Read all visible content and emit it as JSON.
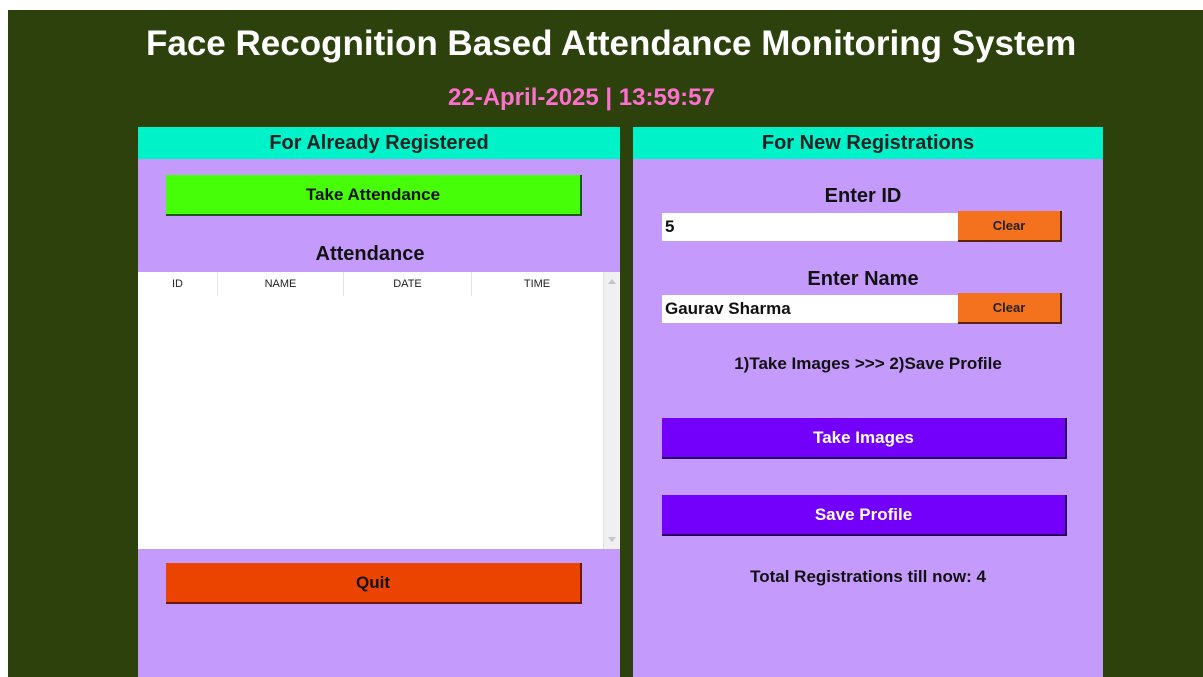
{
  "header": {
    "title": "Face Recognition Based Attendance Monitoring System",
    "datetime": "22-April-2025  | 13:59:57"
  },
  "left_panel": {
    "heading": "For Already Registered",
    "take_attendance_label": "Take Attendance",
    "attendance_label": "Attendance",
    "table": {
      "columns": [
        "ID",
        "NAME",
        "DATE",
        "TIME"
      ],
      "rows": []
    },
    "quit_label": "Quit"
  },
  "right_panel": {
    "heading": "For New Registrations",
    "id_label": "Enter ID",
    "id_value": "5",
    "name_label": "Enter Name",
    "name_value": "Gaurav Sharma",
    "clear_label": "Clear",
    "steps_text": "1)Take Images  >>>  2)Save Profile",
    "take_images_label": "Take Images",
    "save_profile_label": "Save Profile",
    "total_text": "Total Registrations till now: 4"
  },
  "colors": {
    "background": "#2d410d",
    "panel": "#c49bfc",
    "panel_heading": "#00f2c9",
    "take_attendance_button": "#45fe08",
    "quit_button": "#eb4300",
    "purple_buttons": "#7300fb",
    "clear_buttons": "#f4711e",
    "datetime_text": "#ff6fce"
  },
  "icons": {
    "scroll_up": "scroll-up-arrow-icon",
    "scroll_down": "scroll-down-arrow-icon"
  }
}
